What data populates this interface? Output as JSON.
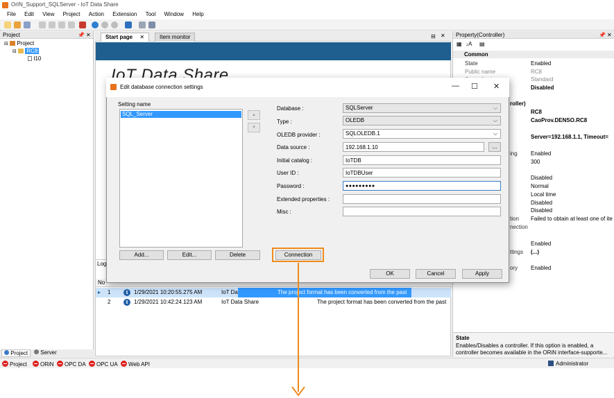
{
  "window": {
    "title": "OrIN_Support_SQLServer - IoT Data Share"
  },
  "menu": [
    "File",
    "Edit",
    "View",
    "Project",
    "Action",
    "Extension",
    "Tool",
    "Window",
    "Help"
  ],
  "project_panel": {
    "title": "Project",
    "tree": {
      "root": "Project",
      "controller": "RC8",
      "child": "I10"
    },
    "bottom_tabs": [
      "Project",
      "Server"
    ]
  },
  "doc_tabs": [
    "Start page",
    "Item monitor"
  ],
  "start_page": {
    "logo": "IoT Data Share"
  },
  "log": {
    "title": "Log",
    "header_no": "No",
    "rows": [
      {
        "no": "1",
        "time": "1/29/2021 10:20:55.275 AM",
        "source": "IoT Data Share",
        "message": "The project format has been converted from the past"
      },
      {
        "no": "2",
        "time": "1/29/2021 10:42:24.123 AM",
        "source": "IoT Data Share",
        "message": "The project format has been converted from the past"
      }
    ]
  },
  "property_panel": {
    "title": "Property(Controller)",
    "category_common": "Common",
    "common_rows": [
      {
        "key": "State",
        "value": "Enabled"
      },
      {
        "key": "Public name",
        "value": "RC8"
      },
      {
        "key": "Controller type",
        "value": "Standard"
      },
      {
        "key": "",
        "value": "Disabled"
      }
    ],
    "category_controller": "roller)",
    "controller_rows": [
      {
        "key": "",
        "value": "RC8"
      },
      {
        "key": "",
        "value": "CaoProv.DENSO.RC8"
      },
      {
        "key": "",
        "value": "Server=192.168.1.1, Timeout="
      },
      {
        "key": "ing",
        "value": "Enabled"
      },
      {
        "key": "",
        "value": "300"
      },
      {
        "key": "",
        "value": "Disabled"
      },
      {
        "key": "",
        "value": "Normal"
      },
      {
        "key": "",
        "value": "Local time"
      },
      {
        "key": "",
        "value": "Disabled"
      },
      {
        "key": "",
        "value": "Disabled"
      },
      {
        "key": "tion",
        "value": "Failed to obtain at least one of ite"
      },
      {
        "key": "nection",
        "value": ""
      },
      {
        "key": "",
        "value": "Enabled"
      },
      {
        "key": "ttings",
        "value": "(...)"
      },
      {
        "key": "ory",
        "value": "Enabled"
      }
    ],
    "desc_title": "State",
    "desc_text1": "Enables/Disables a controller. If this option is enabled, a",
    "desc_text2": "controller becomes available in the ORiN interface-supporte..."
  },
  "statusbar": {
    "items": [
      "Project",
      "ORiN",
      "OPC DA",
      "OPC UA",
      "Web API"
    ],
    "user": "Administrator"
  },
  "dialog": {
    "title": "Edit database connection settings",
    "setting_name_label": "Setting name",
    "settings": [
      "SQL_Server"
    ],
    "buttons": {
      "add": "Add...",
      "edit": "Edit...",
      "delete": "Delete",
      "connection": "Connection",
      "ok": "OK",
      "cancel": "Cancel",
      "apply": "Apply",
      "browse": "..."
    },
    "fields": {
      "database_label": "Database :",
      "database_value": "SQLServer",
      "type_label": "Type :",
      "type_value": "OLEDB",
      "provider_label": "OLEDB provider :",
      "provider_value": "SQLOLEDB.1",
      "datasource_label": "Data source :",
      "datasource_value": "192.168.1.10",
      "catalog_label": "Initial catalog :",
      "catalog_value": "IoTDB",
      "userid_label": "User ID :",
      "userid_value": "IoTDBUser",
      "password_label": "Password :",
      "password_value": "●●●●●●●●●",
      "extended_label": "Extended properties :",
      "extended_value": "",
      "misc_label": "Misc :",
      "misc_value": ""
    }
  },
  "colors": {
    "highlight": "#f08a1c",
    "selection": "#3399ff",
    "banner": "#1e5f8f"
  }
}
